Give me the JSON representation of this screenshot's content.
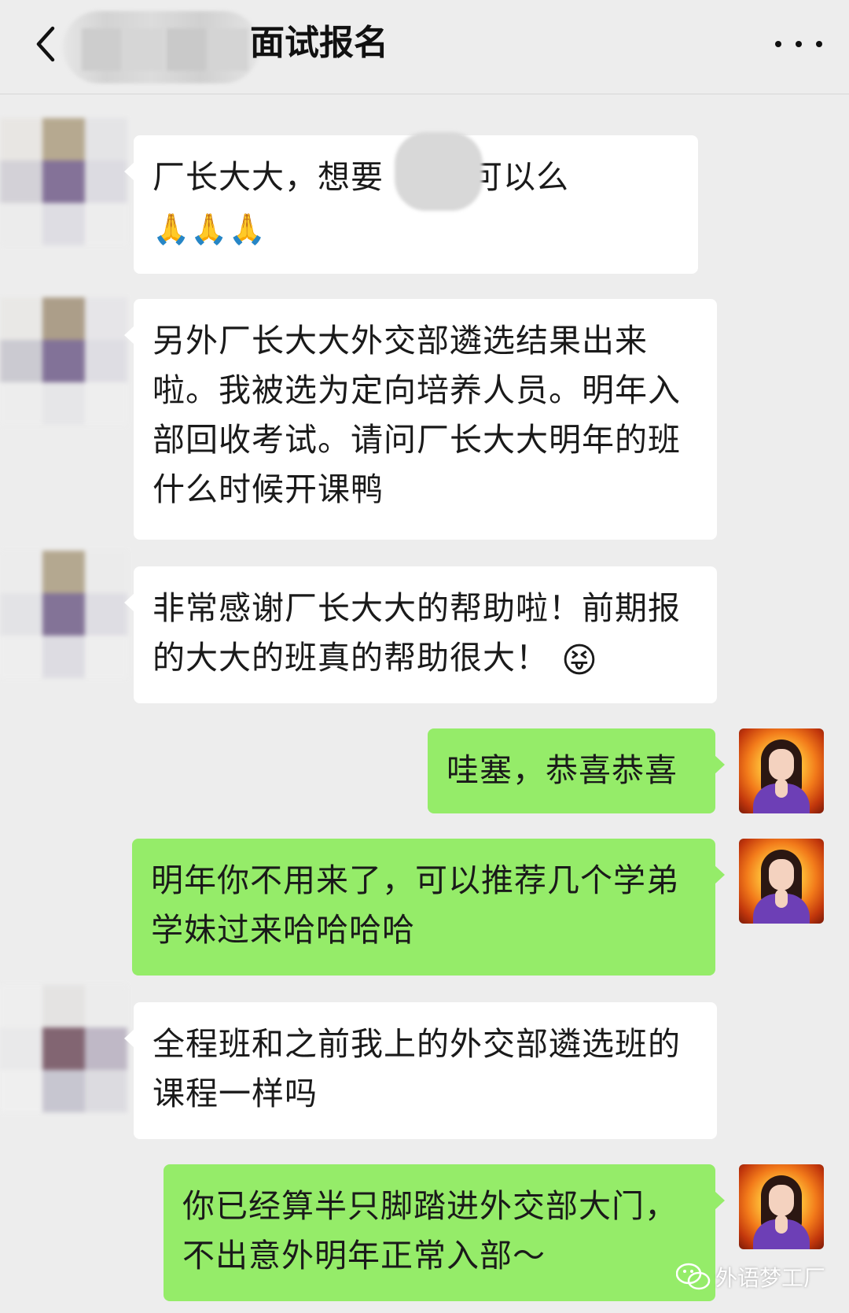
{
  "header": {
    "title": "面试报名",
    "back_icon": "chevron-left-icon",
    "more_icon": "ellipsis-icon"
  },
  "messages": [
    {
      "side": "left",
      "text_before": "厂长大大，想要",
      "text_after": "可以么",
      "emoji": "🙏🙏🙏"
    },
    {
      "side": "left",
      "text": "另外厂长大大外交部遴选结果出来啦。我被选为定向培养人员。明年入部回收考试。请问厂长大大明年的班什么时候开课鸭"
    },
    {
      "side": "left",
      "text": "非常感谢厂长大大的帮助啦！前期报的大大的班真的帮助很大！",
      "emoji": "😝"
    },
    {
      "side": "right",
      "text": "哇塞，恭喜恭喜"
    },
    {
      "side": "right",
      "text": "明年你不用来了，可以推荐几个学弟学妹过来哈哈哈哈"
    },
    {
      "side": "left",
      "text": "全程班和之前我上的外交部遴选班的课程一样吗"
    },
    {
      "side": "right",
      "text": "你已经算半只脚踏进外交部大门，不出意外明年正常入部～"
    }
  ],
  "watermark": {
    "text": "外语梦工厂",
    "icon": "wechat-icon"
  },
  "colors": {
    "background": "#ededed",
    "left_bubble": "#ffffff",
    "right_bubble": "#95ec69"
  }
}
